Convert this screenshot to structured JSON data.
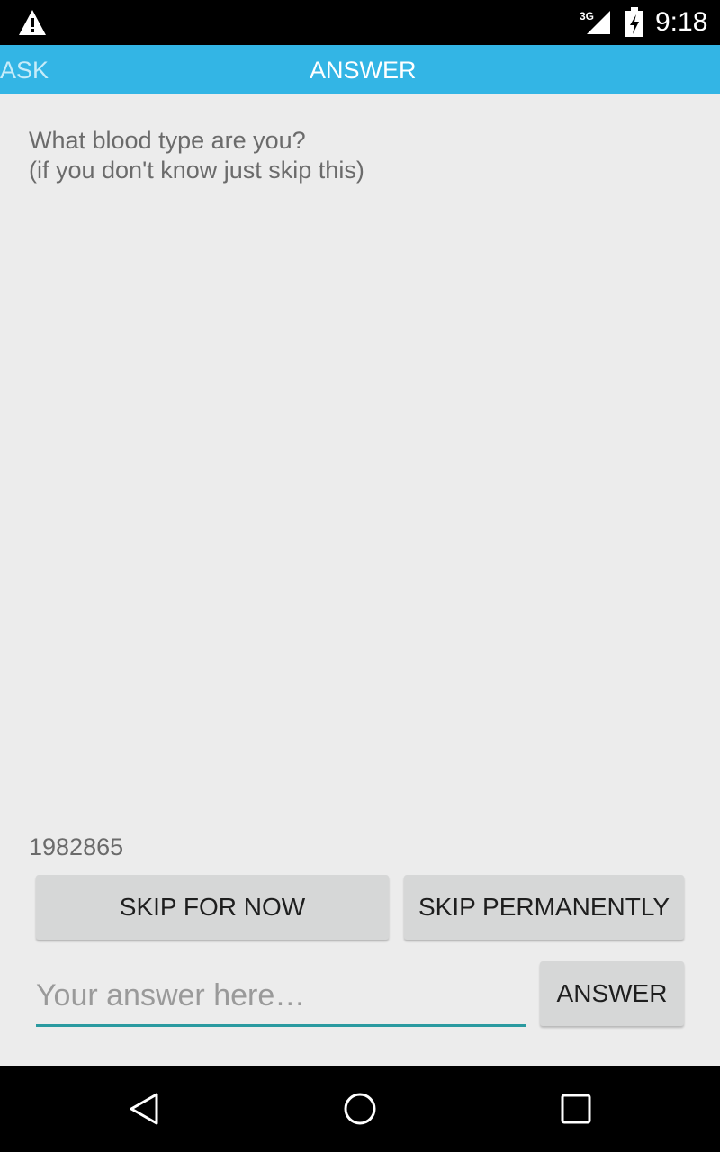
{
  "status_bar": {
    "time": "9:18",
    "network": "3G",
    "icons": [
      "warning-icon",
      "signal-3g-icon",
      "battery-charging-icon"
    ]
  },
  "tabs": [
    {
      "label": "ASK",
      "selected": false
    },
    {
      "label": "ANSWER",
      "selected": true
    }
  ],
  "question": {
    "line1": "What blood type are you?",
    "line2": "(if you don't know just skip this)"
  },
  "question_id": "1982865",
  "buttons": {
    "skip_now": "SKIP FOR NOW",
    "skip_permanently": "SKIP PERMANENTLY",
    "answer": "ANSWER"
  },
  "answer_input": {
    "placeholder": "Your answer here…",
    "value": ""
  },
  "navigation": [
    "back-icon",
    "home-icon",
    "recents-icon"
  ],
  "colors": {
    "accent": "#33b5e5",
    "input_underline": "#2a9aa0",
    "background": "#ececec"
  }
}
